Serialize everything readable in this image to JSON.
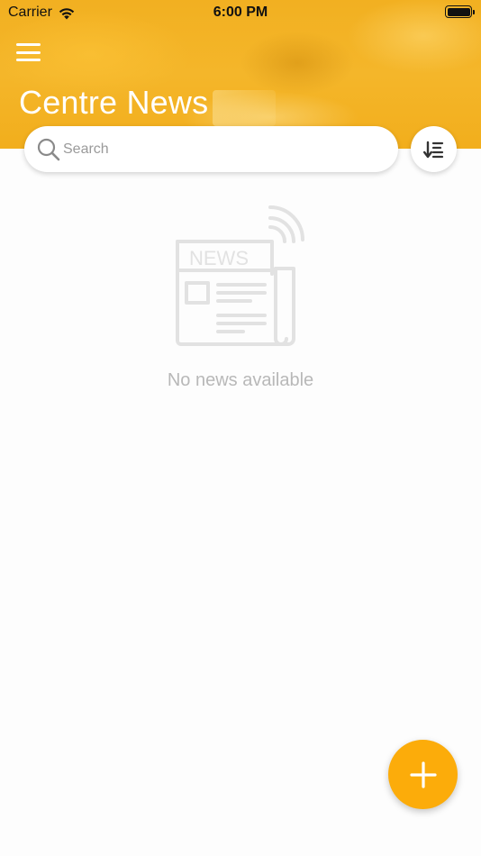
{
  "status_bar": {
    "carrier": "Carrier",
    "time": "6:00 PM",
    "wifi_icon": "wifi-icon",
    "battery_icon": "battery-full-icon"
  },
  "header": {
    "menu_icon": "hamburger-menu-icon",
    "title": "Centre News",
    "background_color": "#f2b021"
  },
  "search": {
    "placeholder": "Search",
    "value": "",
    "icon": "search-icon"
  },
  "sort": {
    "icon": "sort-descending-icon"
  },
  "empty_state": {
    "illustration": "newspaper-icon",
    "illustration_text": "NEWS",
    "message": "No news available"
  },
  "fab": {
    "icon": "plus-icon",
    "color": "#fcac0a"
  }
}
